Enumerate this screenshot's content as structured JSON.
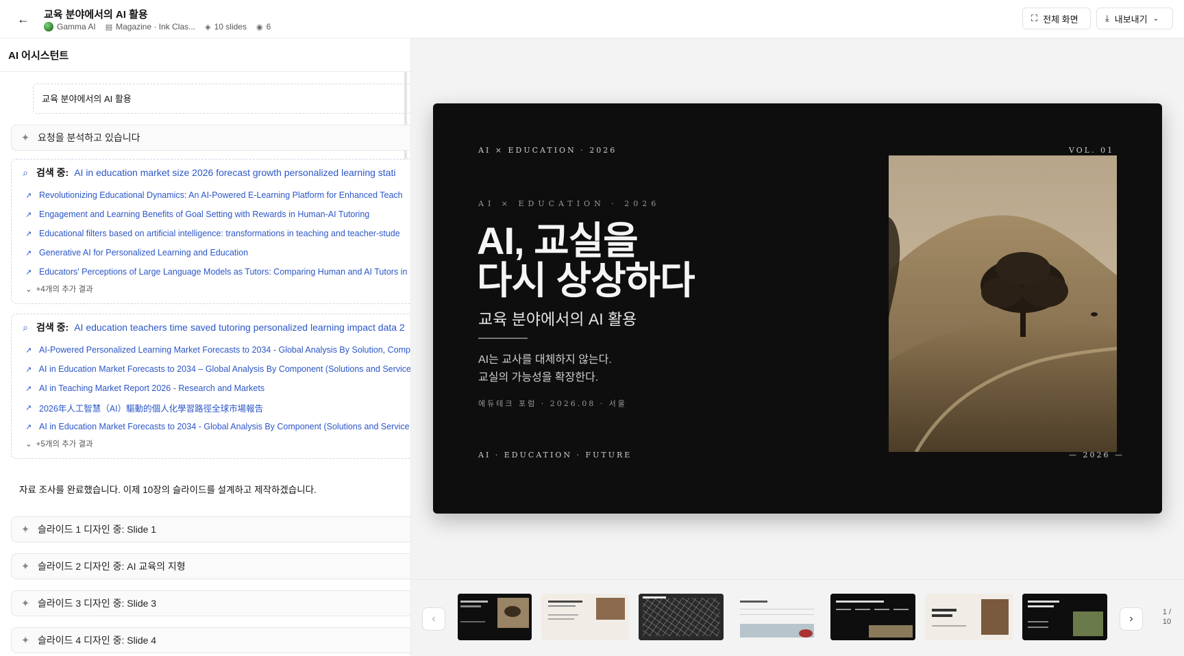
{
  "header": {
    "title": "교육 분야에서의 AI 활용",
    "author": "Gamma AI",
    "theme": "Magazine · Ink Clas...",
    "slides": "10 slides",
    "views": "6",
    "fullscreen_label": "전체 화면",
    "export_label": "내보내기"
  },
  "assistant": {
    "title": "AI 어시스턴트",
    "prompt": "교육 분야에서의 AI 활용",
    "analyzing": "요청을 분석하고 있습니다",
    "search_label": "검색 중:",
    "searches": [
      {
        "query": "AI in education market size 2026 forecast growth personalized learning stati",
        "results": [
          "Revolutionizing Educational Dynamics: An AI-Powered E-Learning Platform for Enhanced Teach",
          "Engagement and Learning Benefits of Goal Setting with Rewards in Human-AI Tutoring",
          "Educational filters based on artificial intelligence: transformations in teaching and teacher-stude",
          "Generative AI for Personalized Learning and Education",
          "Educators' Perceptions of Large Language Models as Tutors: Comparing Human and AI Tutors in"
        ],
        "more": "+4개의 추가 결과"
      },
      {
        "query": "AI education teachers time saved tutoring personalized learning impact data 2",
        "results": [
          "AI-Powered Personalized Learning Market Forecasts to 2034 - Global Analysis By Solution, Comp",
          "AI in Education Market Forecasts to 2034 – Global Analysis By Component (Solutions and Service",
          "AI in Teaching Market Report 2026 - Research and Markets",
          "2026年人工智慧（AI）驅動的個人化學習路徑全球市場報告",
          "AI in Education Market Forecasts to 2034 - Global Analysis By Component (Solutions and Service"
        ],
        "more": "+5개의 추가 결과"
      }
    ],
    "done_text": "자료 조사를 완료했습니다. 이제 10장의 슬라이드를 설계하고 제작하겠습니다.",
    "designing": [
      "슬라이드 1 디자인 중: Slide 1",
      "슬라이드 2 디자인 중: AI 교육의 지형",
      "슬라이드 3 디자인 중: Slide 3",
      "슬라이드 4 디자인 중: Slide 4"
    ]
  },
  "slide": {
    "top_left": "AI × EDUCATION · 2026",
    "top_right": "VOL. 01",
    "kicker": "AI × EDUCATION · 2026",
    "headline_line1": "AI, 교실을",
    "headline_line2": "다시 상상하다",
    "subtitle": "교육 분야에서의 AI 활용",
    "body_line1": "AI는 교사를 대체하지 않는다.",
    "body_line2": "교실의 가능성을 확장한다.",
    "event": "에듀테크 포럼 · 2026.08 · 서울",
    "foot_left": "AI · EDUCATION · FUTURE",
    "foot_right": "— 2026 —"
  },
  "pager": {
    "current": "1 /",
    "total": "10"
  }
}
